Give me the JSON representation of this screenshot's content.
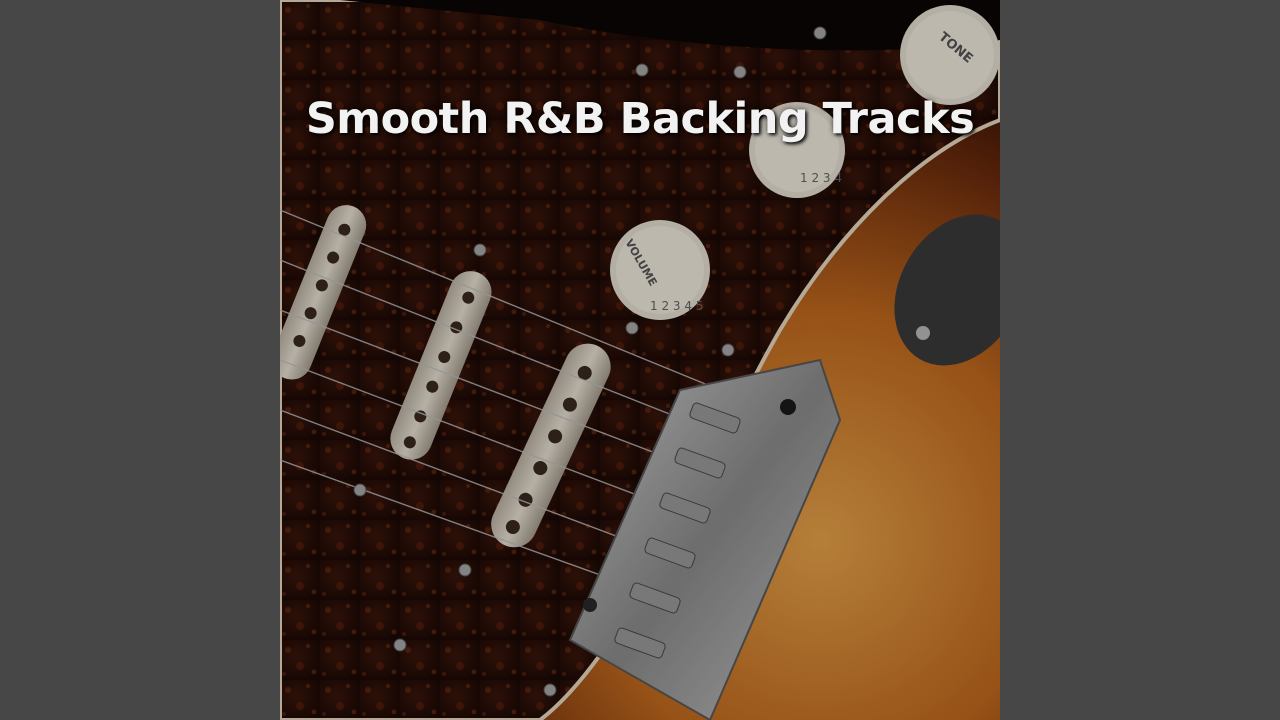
{
  "cover": {
    "title": "Smooth R&B Backing Tracks",
    "knob_labels": {
      "tone": "TONE",
      "volume": "VOLUME"
    }
  },
  "colors": {
    "letterbox": "#474747",
    "pickguard": "#2a0f08",
    "body_sunburst": "#c97a2a",
    "title_text": "#f2f2f2"
  }
}
